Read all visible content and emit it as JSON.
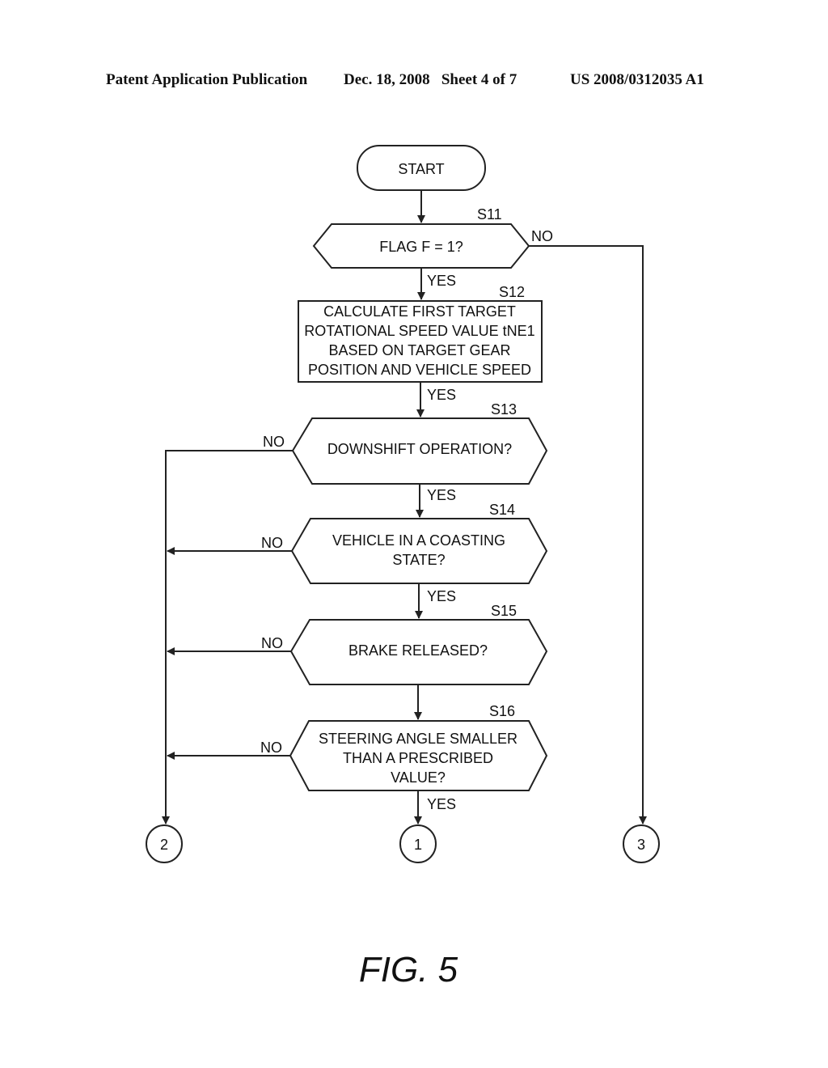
{
  "header": {
    "publication": "Patent Application Publication",
    "date_sheet": "Dec. 18, 2008   Sheet 4 of 7",
    "number": "US 2008/0312035 A1"
  },
  "flowchart": {
    "start": "START",
    "steps": [
      {
        "id": "S11",
        "type": "decision",
        "lines": [
          "FLAG F = 1?"
        ],
        "yes": "YES",
        "no": "NO"
      },
      {
        "id": "S12",
        "type": "process",
        "lines": [
          "CALCULATE FIRST TARGET",
          "ROTATIONAL SPEED VALUE tNE1",
          "BASED ON TARGET GEAR",
          "POSITION AND VEHICLE SPEED"
        ],
        "out": "YES"
      },
      {
        "id": "S13",
        "type": "decision",
        "lines": [
          "DOWNSHIFT OPERATION?"
        ],
        "yes": "YES",
        "no": "NO"
      },
      {
        "id": "S14",
        "type": "decision",
        "lines": [
          "VEHICLE IN A COASTING",
          "STATE?"
        ],
        "yes": "YES",
        "no": "NO"
      },
      {
        "id": "S15",
        "type": "decision",
        "lines": [
          "BRAKE RELEASED?"
        ],
        "yes": "",
        "no": "NO"
      },
      {
        "id": "S16",
        "type": "decision",
        "lines": [
          "STEERING ANGLE SMALLER",
          "THAN A PRESCRIBED",
          "VALUE?"
        ],
        "yes": "YES",
        "no": "NO"
      }
    ],
    "connectors": [
      "2",
      "1",
      "3"
    ]
  },
  "figure_label": "FIG. 5"
}
